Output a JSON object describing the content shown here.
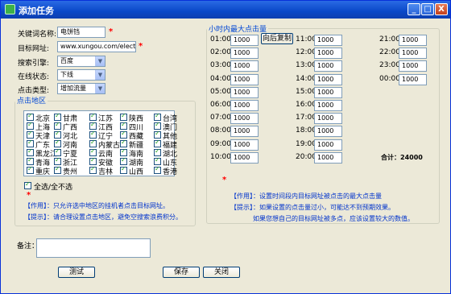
{
  "window": {
    "title": "添加任务",
    "min_glyph": "_",
    "max_glyph": "□",
    "close_glyph": "X"
  },
  "form": {
    "keyword_label": "关键词名称:",
    "keyword_value": "电饼铛",
    "url_label": "目标网址:",
    "url_value": "www.xungou.com/electric-ba",
    "engine_label": "搜索引擎:",
    "engine_value": "百度",
    "online_label": "在线状态:",
    "online_value": "下线",
    "click_type_label": "点击类型:",
    "click_type_value": "增加流量",
    "required_mark": "*"
  },
  "region": {
    "legend": "点击地区",
    "areas": [
      "北京",
      "甘肃",
      "江苏",
      "陕西",
      "台湾",
      "上海",
      "广西",
      "江西",
      "四川",
      "澳门",
      "天津",
      "河北",
      "辽宁",
      "西藏",
      "其他",
      "广东",
      "河南",
      "内蒙古",
      "新疆",
      "福建",
      "黑龙江",
      "宁夏",
      "云南",
      "海南",
      "湖北",
      "青海",
      "浙江",
      "安徽",
      "湖南",
      "山东",
      "重庆",
      "贵州",
      "吉林",
      "山西",
      "香港"
    ],
    "select_all_label": "全选/全不选",
    "tip_effect": "【作用】：只允许选中地区的挂机者点击目标网址。",
    "tip_hint": "【提示】：请合理设置点击地区，避免空搜索浪费积分。"
  },
  "hourly": {
    "legend": "小时内最大点击量",
    "copy_button": "向后复制",
    "col1": [
      {
        "time": "01:00",
        "value": "1000"
      },
      {
        "time": "02:00",
        "value": "1000"
      },
      {
        "time": "03:00",
        "value": "1000"
      },
      {
        "time": "04:00",
        "value": "1000"
      },
      {
        "time": "05:00",
        "value": "1000"
      },
      {
        "time": "06:00",
        "value": "1000"
      },
      {
        "time": "07:00",
        "value": "1000"
      },
      {
        "time": "08:00",
        "value": "1000"
      },
      {
        "time": "09:00",
        "value": "1000"
      },
      {
        "time": "10:00",
        "value": "1000"
      }
    ],
    "col2": [
      {
        "time": "11:00",
        "value": "1000"
      },
      {
        "time": "12:00",
        "value": "1000"
      },
      {
        "time": "13:00",
        "value": "1000"
      },
      {
        "time": "14:00",
        "value": "1000"
      },
      {
        "time": "15:00",
        "value": "1000"
      },
      {
        "time": "16:00",
        "value": "1000"
      },
      {
        "time": "17:00",
        "value": "1000"
      },
      {
        "time": "18:00",
        "value": "1000"
      },
      {
        "time": "19:00",
        "value": "1000"
      },
      {
        "time": "20:00",
        "value": "1000"
      }
    ],
    "col3": [
      {
        "time": "21:00",
        "value": "1000"
      },
      {
        "time": "22:00",
        "value": "1000"
      },
      {
        "time": "23:00",
        "value": "1000"
      },
      {
        "time": "00:00",
        "value": "1000"
      }
    ],
    "total_label": "合计：24000",
    "required_mark": "*",
    "tip_effect": "【作用】：设置时间段内目标网址被点击的最大点击量",
    "tip_hint1": "【提示】：如果设置的点击量过小，可能达不到预期效果。",
    "tip_hint2": "如果您想自己的目标网址被多点，应该设置较大的数值。"
  },
  "note": {
    "label": "备注：",
    "value": ""
  },
  "buttons": {
    "test": "测试",
    "save": "保存",
    "close": "关闭"
  }
}
